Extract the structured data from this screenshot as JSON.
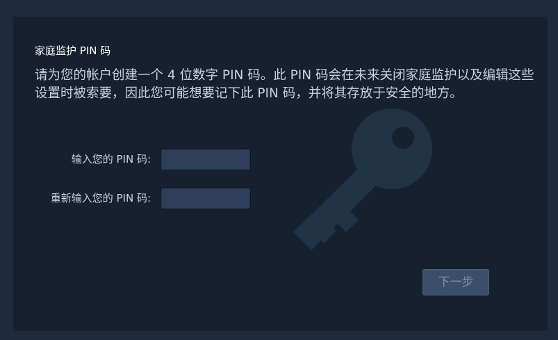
{
  "dialog": {
    "title": "家庭监护 PIN 码",
    "description": "请为您的帐户创建一个 4 位数字 PIN 码。此 PIN 码会在未来关闭家庭监护以及编辑这些设置时被索要，因此您可能想要记下此 PIN 码，并将其存放于安全的地方。",
    "pin_label": "输入您的 PIN 码:",
    "pin_confirm_label": "重新输入您的 PIN 码:",
    "pin_value": "",
    "pin_confirm_value": "",
    "next_button": "下一步"
  },
  "icons": {
    "watermark": "key-icon"
  },
  "colors": {
    "background": "#1f2a3a",
    "panel": "#17202f",
    "input": "#2f3f5a",
    "button": "#3b5068",
    "key_watermark": "#213548"
  }
}
